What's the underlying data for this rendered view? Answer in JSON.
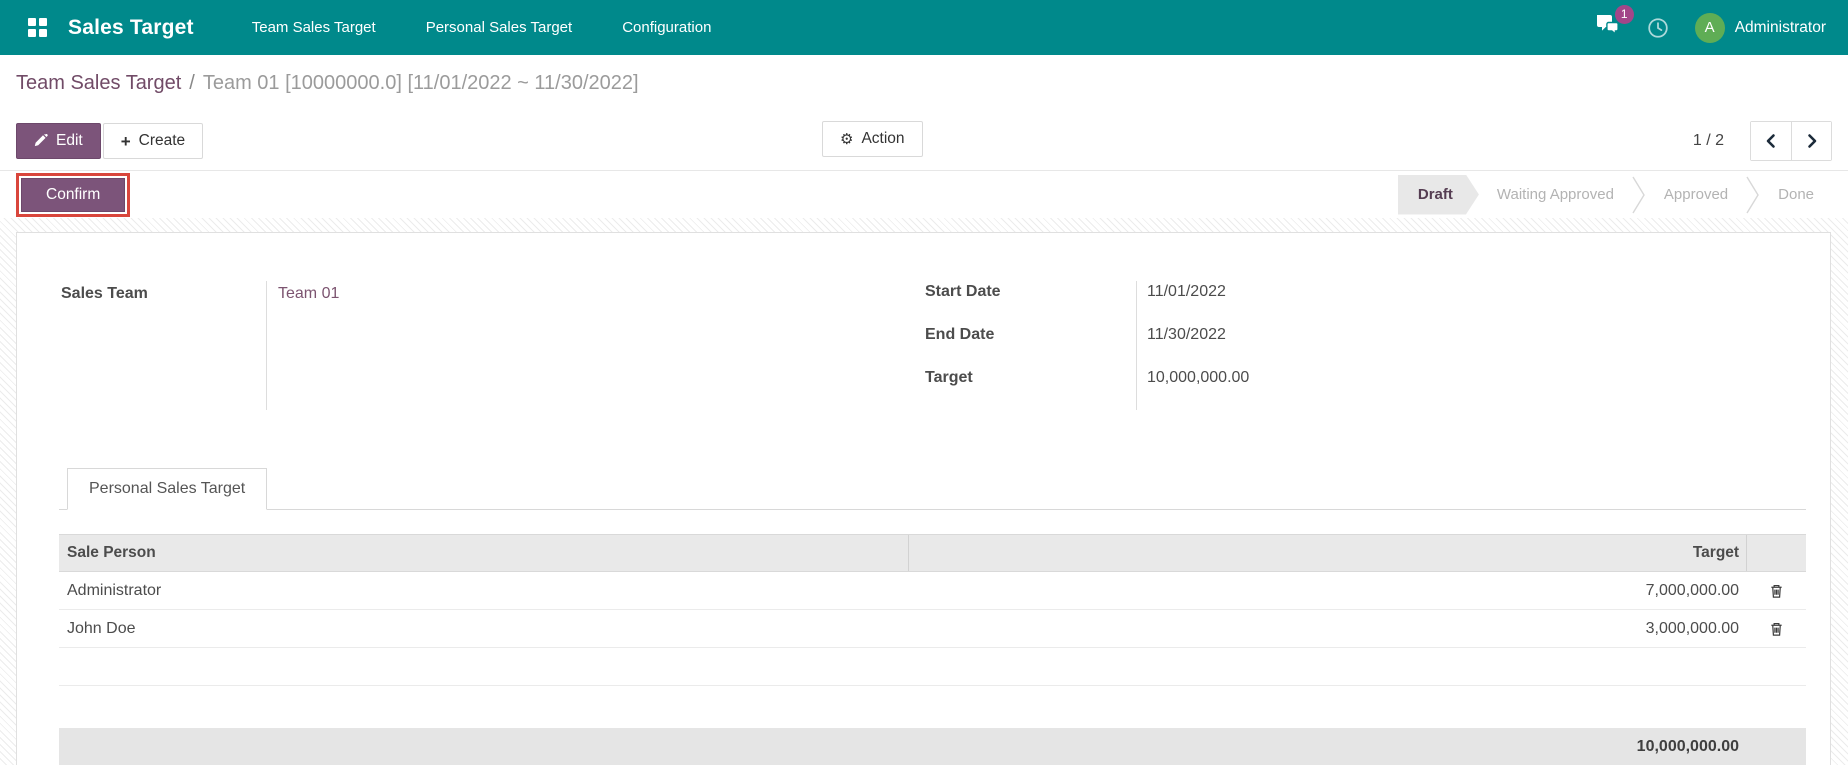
{
  "navbar": {
    "app_title": "Sales Target",
    "menus": [
      {
        "label": "Team Sales Target"
      },
      {
        "label": "Personal Sales Target"
      },
      {
        "label": "Configuration"
      }
    ],
    "messages_badge": "1",
    "user_initial": "A",
    "user_name": "Administrator"
  },
  "breadcrumb": {
    "parent": "Team Sales Target",
    "separator": "/",
    "current": "Team 01 [10000000.0] [11/01/2022 ~ 11/30/2022]"
  },
  "control_panel": {
    "edit_label": "Edit",
    "create_label": "Create",
    "action_label": "Action",
    "pager": "1 / 2"
  },
  "statusbar": {
    "confirm_label": "Confirm",
    "stages": [
      {
        "label": "Draft",
        "active": true
      },
      {
        "label": "Waiting Approved",
        "active": false
      },
      {
        "label": "Approved",
        "active": false
      },
      {
        "label": "Done",
        "active": false
      }
    ]
  },
  "form": {
    "fields_left": [
      {
        "label": "Sales Team",
        "value": "Team 01"
      }
    ],
    "fields_right": [
      {
        "label": "Start Date",
        "value": "11/01/2022"
      },
      {
        "label": "End Date",
        "value": "11/30/2022"
      },
      {
        "label": "Target",
        "value": "10,000,000.00"
      }
    ],
    "tab": "Personal Sales Target",
    "table": {
      "columns": [
        "Sale Person",
        "Target"
      ],
      "rows": [
        {
          "person": "Administrator",
          "target": "7,000,000.00"
        },
        {
          "person": "John Doe",
          "target": "3,000,000.00"
        }
      ],
      "total": "10,000,000.00"
    }
  },
  "colors": {
    "navbar_teal": "#00898b",
    "brand_purple": "#7c547a",
    "breadcrumb_purple": "#714b67",
    "badge_magenta": "#a24689",
    "avatar_green": "#5fad55",
    "highlight_red": "#d9463c",
    "stage_active_bg": "#e8e8e8"
  }
}
